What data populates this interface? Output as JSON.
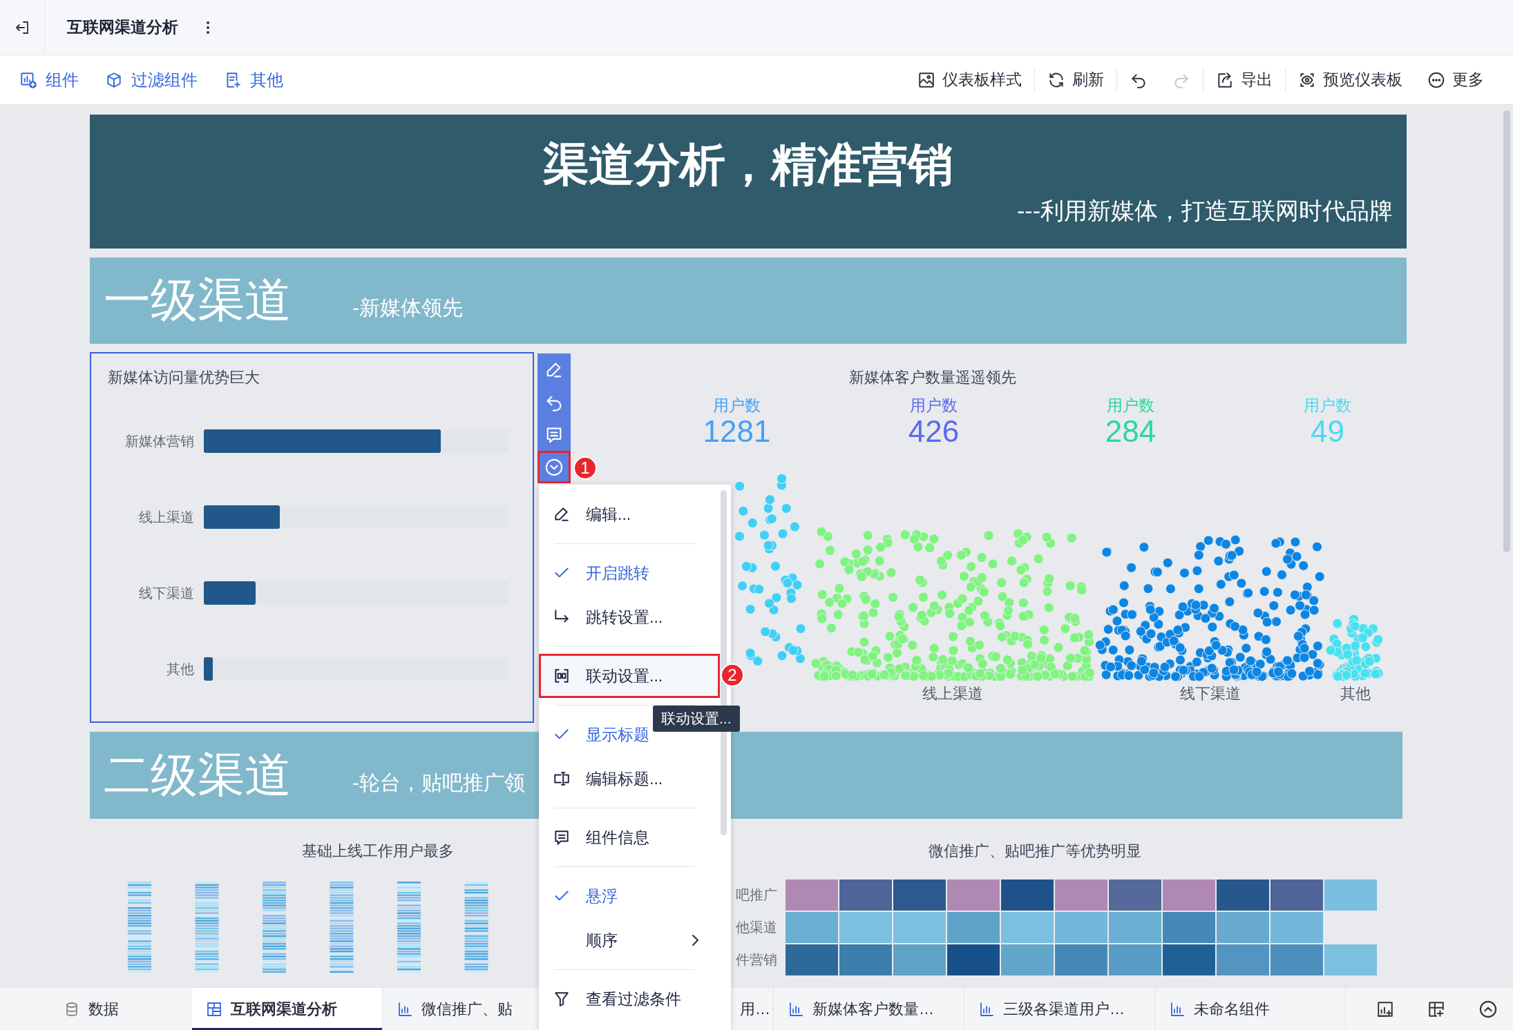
{
  "header": {
    "title": "互联网渠道分析"
  },
  "toolbar": {
    "left": [
      {
        "kind": "widget",
        "label": "组件"
      },
      {
        "kind": "filter",
        "label": "过滤组件"
      },
      {
        "kind": "other",
        "label": "其他"
      }
    ],
    "right": [
      {
        "kind": "style",
        "label": "仪表板样式",
        "disabled": false
      },
      {
        "kind": "refresh",
        "label": "刷新",
        "disabled": false
      },
      {
        "kind": "undo",
        "disabled": false
      },
      {
        "kind": "redo",
        "disabled": true
      },
      {
        "kind": "export",
        "label": "导出",
        "disabled": false
      },
      {
        "kind": "preview",
        "label": "预览仪表板",
        "disabled": false
      },
      {
        "kind": "more",
        "label": "更多",
        "disabled": false
      }
    ]
  },
  "banner": {
    "title": "渠道分析，精准营销",
    "subtitle": "---利用新媒体，打造互联网时代品牌"
  },
  "section_1": {
    "title": "一级渠道",
    "subtitle": "-新媒体领先"
  },
  "bar_widget": {
    "title": "新媒体访问量优势巨大",
    "bars": [
      {
        "label": "新媒体营销",
        "level": 0.78
      },
      {
        "label": "线上渠道",
        "level": 0.25
      },
      {
        "label": "线下渠道",
        "level": 0.17
      },
      {
        "label": "其他",
        "level": 0.03
      }
    ]
  },
  "widget_toolbar": {
    "buttons": [
      {
        "kind": "edit",
        "selected": false
      },
      {
        "kind": "undo",
        "selected": false
      },
      {
        "kind": "comment",
        "selected": false
      },
      {
        "kind": "dropdown",
        "selected": true
      }
    ]
  },
  "scatter_widget": {
    "title": "新媒体客户数量遥遥领先",
    "kpis": [
      {
        "label": "用户数",
        "value": "1281",
        "color": "#45a0f5"
      },
      {
        "label": "用户数",
        "value": "426",
        "color": "#5b6af0"
      },
      {
        "label": "用户数",
        "value": "284",
        "color": "#2ad79a"
      },
      {
        "label": "用户数",
        "value": "49",
        "color": "#4cd8f2"
      }
    ],
    "axis_labels": [
      "线上渠道",
      "线下渠道",
      "其他"
    ]
  },
  "section_2": {
    "title": "二级渠道",
    "subtitle": "-轮台，贴吧推广领"
  },
  "strip_widget": {
    "title": "基础上线工作用户最多"
  },
  "heatmap_widget": {
    "title": "微信推广、贴吧推广等优势明显",
    "rows": [
      {
        "label": "吧推广",
        "cells": [
          {
            "color": "#b088b4"
          },
          {
            "color": "#4f6498"
          },
          {
            "color": "#2d5a8e"
          },
          {
            "color": "#b088b4"
          },
          {
            "color": "#1f528a"
          },
          {
            "color": "#b088b4"
          },
          {
            "color": "#556a9a"
          },
          {
            "color": "#b088b4"
          },
          {
            "color": "#27578c"
          },
          {
            "color": "#4f6498"
          },
          {
            "color": "#7bbfe0"
          }
        ]
      },
      {
        "label": "他渠道",
        "cells": [
          {
            "color": "#6aaed2"
          },
          {
            "color": "#7cc0e0"
          },
          {
            "color": "#7cc0e0"
          },
          {
            "color": "#5ea2c8"
          },
          {
            "color": "#7cc0e0"
          },
          {
            "color": "#72b6da"
          },
          {
            "color": "#6aaed2"
          },
          {
            "color": "#4688b6"
          },
          {
            "color": "#68aace"
          },
          {
            "color": "#72b6da"
          }
        ]
      },
      {
        "label": "件营销",
        "cells": [
          {
            "color": "#2d6a9a"
          },
          {
            "color": "#3b7eac"
          },
          {
            "color": "#5ea2c8"
          },
          {
            "color": "#175088"
          },
          {
            "color": "#62a6ca"
          },
          {
            "color": "#4688b6"
          },
          {
            "color": "#589cc6"
          },
          {
            "color": "#206194"
          },
          {
            "color": "#5494c0"
          },
          {
            "color": "#4c8ebc"
          },
          {
            "color": "#7cc0e0"
          }
        ]
      }
    ]
  },
  "context_menu": {
    "items": [
      {
        "kind": "edit",
        "label": "编辑...",
        "selected": false
      },
      {
        "kind": "divider"
      },
      {
        "kind": "check",
        "label": "开启跳转",
        "checked": true,
        "selected": false
      },
      {
        "kind": "jump",
        "label": "跳转设置...",
        "selected": false
      },
      {
        "kind": "divider"
      },
      {
        "kind": "link",
        "label": "联动设置...",
        "selected": true
      },
      {
        "kind": "divider"
      },
      {
        "kind": "check",
        "label": "显示标题",
        "checked": true,
        "selected": false
      },
      {
        "kind": "rename",
        "label": "编辑标题...",
        "selected": false
      },
      {
        "kind": "divider"
      },
      {
        "kind": "info",
        "label": "组件信息",
        "selected": false
      },
      {
        "kind": "divider"
      },
      {
        "kind": "check",
        "label": "悬浮",
        "checked": true,
        "selected": false
      },
      {
        "kind": "submenu",
        "label": "顺序",
        "selected": false
      },
      {
        "kind": "divider"
      },
      {
        "kind": "filter",
        "label": "查看过滤条件",
        "selected": false
      }
    ]
  },
  "tooltip": "联动设置...",
  "annotations": [
    "1",
    "2"
  ],
  "bottom_tabs": [
    {
      "kind": "data",
      "label": "数据",
      "selected": false
    },
    {
      "kind": "dashboard",
      "label": "互联网渠道分析",
      "selected": true
    },
    {
      "kind": "chart",
      "label": "微信推广、贴",
      "selected": false
    },
    {
      "kind": "clipped",
      "label": "用…",
      "selected": false
    },
    {
      "kind": "chart",
      "label": "新媒体客户数量…",
      "selected": false
    },
    {
      "kind": "chart",
      "label": "三级各渠道用户…",
      "selected": false
    },
    {
      "kind": "chart",
      "label": "未命名组件",
      "selected": false
    }
  ]
}
